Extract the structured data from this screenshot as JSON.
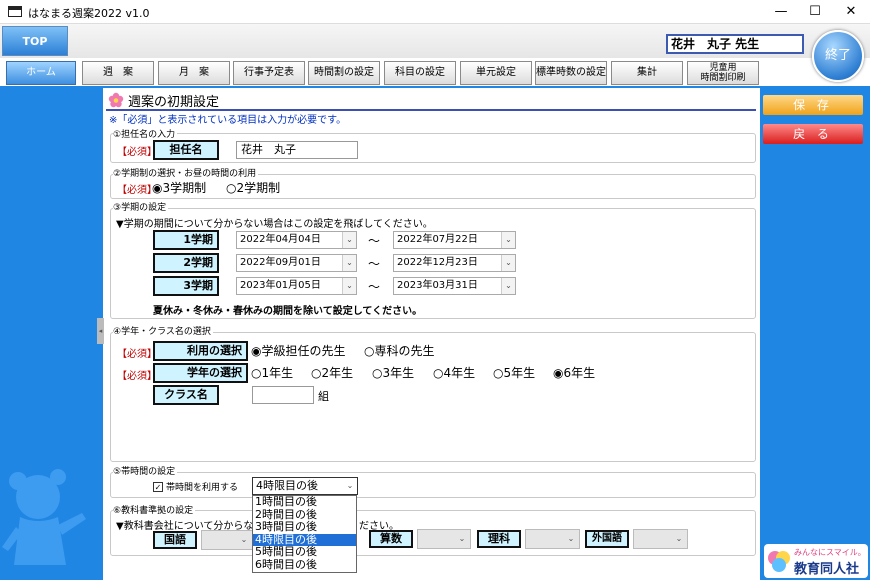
{
  "window": {
    "title": "はなまる週案2022 v1.0",
    "minimize": "—",
    "maximize": "☐",
    "close": "✕"
  },
  "top_button": "TOP",
  "user_name": "花井　丸子 先生",
  "exit_button": "終了",
  "nav": [
    {
      "label": "ホーム",
      "active": true
    },
    {
      "label": "週　案"
    },
    {
      "label": "月　案"
    },
    {
      "label": "行事予定表"
    },
    {
      "label": "時間割の設定"
    },
    {
      "label": "科目の設定"
    },
    {
      "label": "単元設定"
    },
    {
      "label": "標準時数の設定"
    },
    {
      "label": "集計"
    },
    {
      "label": "児童用\n時間割印刷"
    }
  ],
  "page": {
    "title": "週案の初期設定",
    "notice": "※「必須」と表示されている項目は入力が必要です。"
  },
  "side_buttons": {
    "save": "保 存",
    "back": "戻 る"
  },
  "required": "【必須】",
  "sec1": {
    "title": "①担任名の入力",
    "label": "担任名",
    "value": "花井　丸子"
  },
  "sec2": {
    "title": "②学期制の選択・お昼の時間の利用",
    "opt1": "3学期制",
    "opt2": "2学期制"
  },
  "sec3": {
    "title": "③学期の設定",
    "hint": "▼学期の期間について分からない場合はこの設定を飛ばしてください。",
    "terms": [
      {
        "label": "1学期",
        "start": "2022年04月04日",
        "end": "2022年07月22日"
      },
      {
        "label": "2学期",
        "start": "2022年09月01日",
        "end": "2022年12月23日"
      },
      {
        "label": "3学期",
        "start": "2023年01月05日",
        "end": "2023年03月31日"
      }
    ],
    "tilde": "〜",
    "footnote": "夏休み・冬休み・春休みの期間を除いて設定してください。"
  },
  "sec4": {
    "title": "④学年・クラス名の選択",
    "usage_label": "利用の選択",
    "usage_opt1": "学級担任の先生",
    "usage_opt2": "専科の先生",
    "grade_label": "学年の選択",
    "grades": [
      "1年生",
      "2年生",
      "3年生",
      "4年生",
      "5年生",
      "6年生"
    ],
    "class_label": "クラス名",
    "class_suffix": "組"
  },
  "sec5": {
    "title": "⑤帯時間の設定",
    "checkbox_label": "帯時間を利用する",
    "selected": "4時限目の後",
    "options": [
      "1時間目の後",
      "2時間目の後",
      "3時間目の後",
      "4時限目の後",
      "5時間目の後",
      "6時間目の後"
    ]
  },
  "sec6": {
    "title": "⑥教科書準拠の設定",
    "hint_a": "▼教科書会社について分からない",
    "hint_b": "ださい。",
    "subjects": [
      "国語",
      "算数",
      "理科",
      "外国語"
    ]
  },
  "publisher": {
    "tagline": "みんなにスマイル。",
    "name": "教育同人社"
  }
}
